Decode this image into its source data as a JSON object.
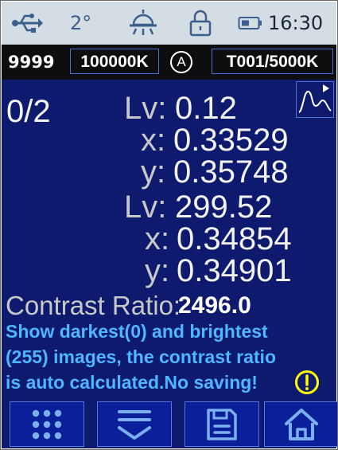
{
  "status_bar": {
    "temperature": "2°",
    "time": "16:30",
    "icons": [
      "usb-icon",
      "siren-light-icon",
      "lock-icon",
      "battery-icon"
    ]
  },
  "info_bar": {
    "count": "9999",
    "range": "100000K",
    "mode": "A",
    "channel": "T001/5000K"
  },
  "measurement": {
    "index": "0/2",
    "readings": [
      {
        "lv_label": "Lv:",
        "lv": "0.12",
        "x_label": "x:",
        "x": "0.33529",
        "y_label": "y:",
        "y": "0.35748"
      },
      {
        "lv_label": "Lv:",
        "lv": "299.52",
        "x_label": "x:",
        "x": "0.34854",
        "y_label": "y:",
        "y": "0.34901"
      }
    ],
    "contrast_label": "Contrast Ratio:",
    "contrast_value": "2496.0"
  },
  "note": {
    "lines": [
      "Show darkest(0) and brightest",
      "(255) images, the contrast ratio",
      "is auto calculated.No saving!"
    ]
  },
  "toolbar": {
    "buttons": [
      "grid-menu-icon",
      "collapse-icon",
      "save-icon",
      "home-icon"
    ]
  },
  "colors": {
    "background": "#0d1a6e",
    "status_bar": "#d4dce4",
    "info_bar": "#0e0e10",
    "note_text": "#4fb6ff",
    "warning": "#ffff00",
    "button": "#0c1f9a"
  }
}
